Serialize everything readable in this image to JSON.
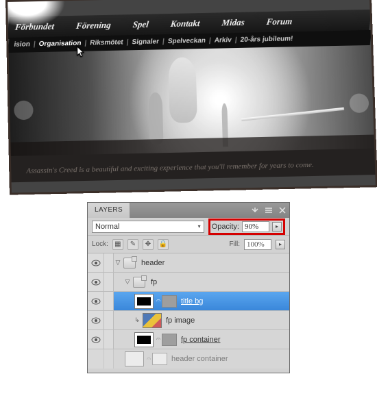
{
  "site": {
    "topnav": [
      "Förbundet",
      "Förening",
      "Spel",
      "Kontakt",
      "Midas",
      "Forum"
    ],
    "subnav": [
      "ision",
      "Organisation",
      "Riksmötet",
      "Signaler",
      "Spelveckan",
      "Arkiv",
      "20-års jubileum!"
    ],
    "subnav_active_index": 1,
    "tagline": "Assassin's Creed is a beautiful and exciting experience that you'll remember for years to come."
  },
  "panel": {
    "tab": "LAYERS",
    "blend_mode": "Normal",
    "opacity_label": "Opacity:",
    "opacity_value": "90%",
    "lock_label": "Lock:",
    "fill_label": "Fill:",
    "fill_value": "100%",
    "lock_icons": [
      "transparent-pixels",
      "paint",
      "move",
      "all"
    ],
    "layers": [
      {
        "type": "group",
        "name": "header",
        "depth": 0
      },
      {
        "type": "group",
        "name": "fp",
        "depth": 1
      },
      {
        "type": "layer",
        "name": "title bg",
        "depth": 2,
        "selected": true,
        "thumb": "blk",
        "mask": "grey"
      },
      {
        "type": "layer",
        "name": "fp image",
        "depth": 2,
        "thumb": "img",
        "clip": true
      },
      {
        "type": "layer",
        "name": "fp container",
        "depth": 2,
        "thumb": "blk",
        "mask": "grey"
      },
      {
        "type": "layer",
        "name": "header container",
        "depth": 1,
        "thumb": "wht",
        "mask": "wht"
      }
    ]
  }
}
